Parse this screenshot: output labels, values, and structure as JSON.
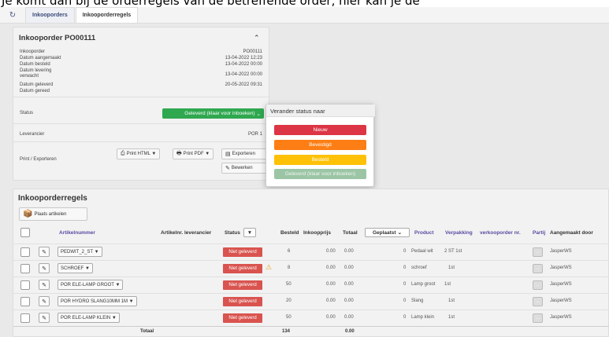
{
  "banner_text": "Je komt dan bij de orderregels van de betreffende order, hier kan je de",
  "tabs": [
    {
      "label": "Inkooporders"
    },
    {
      "label": "Inkooporderregels"
    }
  ],
  "order": {
    "title": "Inkooporder PO00111",
    "fields": [
      {
        "label": "Inkooporder",
        "value": "PO00111"
      },
      {
        "label": "Datum aangemaakt",
        "value": "13-04-2022 12:23"
      },
      {
        "label": "Datum besteld",
        "value": "13-04-2022 00:00"
      },
      {
        "label": "Datum levering verwacht",
        "value": "13-04-2022 00:00"
      },
      {
        "label": "Datum geleverd",
        "value": "20-05-2022 09:31"
      },
      {
        "label": "Datum gereed",
        "value": ""
      }
    ],
    "status_label": "Status",
    "status_value": "Geleverd (klaar voor inboeken)",
    "supplier_label": "Leverancier",
    "supplier_value": "POR 1",
    "print_label": "Print / Exporteren",
    "buttons": {
      "print_html": "Print HTML ▼",
      "print_pdf": "Print PDF ▼",
      "export": "Exporteren",
      "edit": "Bewerken"
    }
  },
  "status_popup": {
    "title": "Verander status naar",
    "options": [
      {
        "label": "Nieuw",
        "color": "#dc3545"
      },
      {
        "label": "Bevestigd",
        "color": "#fd7e14"
      },
      {
        "label": "Besteld",
        "color": "#ffc107"
      },
      {
        "label": "Geleverd (klaar voor inboeken)",
        "color": "#9cc5a6"
      }
    ]
  },
  "lines": {
    "title": "Inkooporderregels",
    "add_button": "Plaats artikelen",
    "headers": {
      "article": "Artikelnummer",
      "supplier_article": "Artikelnr. leverancier",
      "status": "Status",
      "ordered": "Besteld",
      "price": "Inkoopprijs",
      "total": "Totaal",
      "placed": "Geplaatst",
      "product": "Product",
      "packaging": "Verpakking",
      "sales_order": "verkooporder nr.",
      "batch": "Partij",
      "created_by": "Aangemaakt door"
    },
    "rows": [
      {
        "article": "PEDWIT_2_ST ▼",
        "status": "Niet geleverd",
        "warn": false,
        "ordered": "6",
        "price": "0.00",
        "total": "0.00",
        "placed": "0",
        "product": "Pedaal wit",
        "packaging": "2 ST 1st",
        "created_by": "JasperWS"
      },
      {
        "article": "SCHROEF ▼",
        "status": "Niet geleverd",
        "warn": true,
        "ordered": "8",
        "price": "0.00",
        "total": "0.00",
        "placed": "0",
        "product": "schroef",
        "packaging": "1st",
        "created_by": "JasperWS"
      },
      {
        "article": "POR ELE-LAMP GROOT ▼",
        "status": "Niet geleverd",
        "warn": false,
        "ordered": "50",
        "price": "0.00",
        "total": "0.00",
        "placed": "0",
        "product": "Lamp groot",
        "packaging": "1st",
        "created_by": "JasperWS"
      },
      {
        "article": "POR HYDRO SLANG10MM 1M ▼",
        "status": "Niet geleverd",
        "warn": false,
        "ordered": "20",
        "price": "0.00",
        "total": "0.00",
        "placed": "0",
        "product": "Slang",
        "packaging": "1st",
        "created_by": "JasperWS"
      },
      {
        "article": "POR ELE-LAMP KLEIN ▼",
        "status": "Niet geleverd",
        "warn": false,
        "ordered": "50",
        "price": "0.00",
        "total": "0.00",
        "placed": "0",
        "product": "Lamp klein",
        "packaging": "1st",
        "created_by": "JasperWS"
      }
    ],
    "total_label": "Totaal",
    "total_ordered": "134",
    "total_amount": "0.00"
  }
}
